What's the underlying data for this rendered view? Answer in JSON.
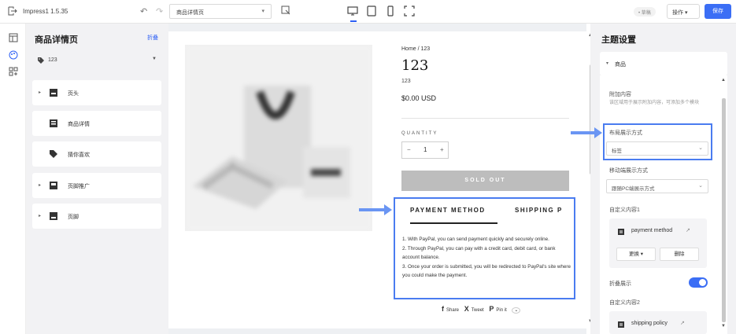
{
  "topbar": {
    "app_name": "Impress1 1.5.35",
    "undo_icon": "undo-icon",
    "redo_icon": "redo-icon",
    "page_select_value": "商品详情页",
    "draft_badge": "• 草稿",
    "ops_label": "操作 ▾",
    "save_label": "保存"
  },
  "left_panel": {
    "title": "商品详情页",
    "collapse_label": "折叠",
    "template_select": "123",
    "items": [
      {
        "label": "页头",
        "expandable": true
      },
      {
        "label": "商品详情",
        "expandable": false
      },
      {
        "label": "猜你喜欢",
        "expandable": false
      },
      {
        "label": "页脚推广",
        "expandable": true
      },
      {
        "label": "页脚",
        "expandable": true
      }
    ]
  },
  "product": {
    "breadcrumb": "Home / 123",
    "title": "123",
    "sku": "123",
    "price": "$0.00 USD",
    "quantity_label": "QUANTITY",
    "qty_minus": "−",
    "qty_value": "1",
    "qty_plus": "+",
    "sold_out": "SOLD OUT",
    "tab_payment": "PAYMENT METHOD",
    "tab_shipping": "SHIPPING P",
    "payment_lines": [
      "1. With PayPal, you can send payment quickly and securely online.",
      "2. Through PayPal, you can pay with a credit card, debit card, or bank account balance.",
      "3. Once your order is submitted, you will be redirected to PayPal's site where you could make the payment."
    ],
    "share": {
      "share": "Share",
      "tweet": "Tweet",
      "pin": "Pin it"
    }
  },
  "right_panel": {
    "title": "主题设置",
    "section": "商品",
    "extra_content_label": "附加内容",
    "extra_content_hint": "该区域用于展示附加内容，可添加多个模块",
    "layout_label": "布局展示方式",
    "layout_value": "标签",
    "mobile_layout_label": "移动端展示方式",
    "mobile_layout_value": "跟随PC端展示方式",
    "custom1_label": "自定义内容1",
    "custom1_name": "payment method",
    "custom1_change": "更换 ▾",
    "custom1_delete": "删除",
    "fold_label": "折叠展示",
    "custom2_label": "自定义内容2",
    "custom2_name": "shipping policy"
  },
  "colors": {
    "accent": "#3b6ef5",
    "highlight": "#4a7cf0"
  }
}
